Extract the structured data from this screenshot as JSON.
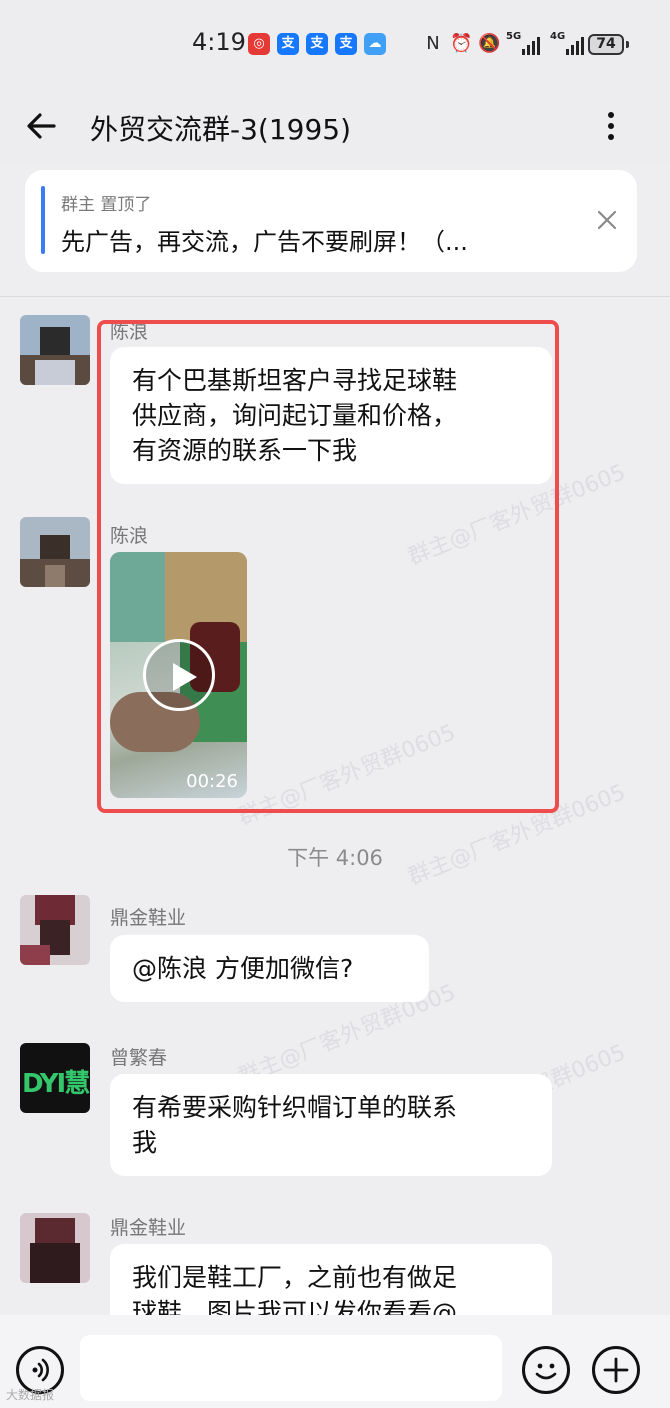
{
  "status_bar": {
    "time": "4:19",
    "network_1": "5G",
    "network_2": "4G",
    "battery": "74"
  },
  "header": {
    "title": "外贸交流群-3(1995)"
  },
  "pinned": {
    "meta": "群主 置顶了",
    "text": "先广告，再交流，广告不要刷屏！（..."
  },
  "messages": [
    {
      "sender": "陈浪",
      "text": "有个巴基斯坦客户寻找足球鞋\n供应商，询问起订量和价格，\n有资源的联系一下我"
    },
    {
      "sender": "陈浪",
      "video_duration": "00:26"
    },
    {
      "sender": "鼎金鞋业",
      "text": "@陈浪 方便加微信?"
    },
    {
      "sender": "曾繁春",
      "avatar_text": "DYI慧",
      "text": "有希要采购针织帽订单的联系\n我"
    },
    {
      "sender": "鼎金鞋业",
      "text": "我们是鞋工厂，之前也有做足\n球鞋，图片我可以发你看看@"
    }
  ],
  "time_divider": "下午 4:06",
  "watermark": "群主@厂客外贸群0605",
  "corner_mark": "大数据报",
  "colors": {
    "highlight": "#ee4d4d",
    "accent": "#3b7cf0",
    "background": "#eeeef1",
    "bubble": "#ffffff"
  },
  "icons": [
    "back-arrow-icon",
    "more-icon",
    "close-icon",
    "play-icon",
    "voice-icon",
    "emoji-icon",
    "plus-icon"
  ]
}
